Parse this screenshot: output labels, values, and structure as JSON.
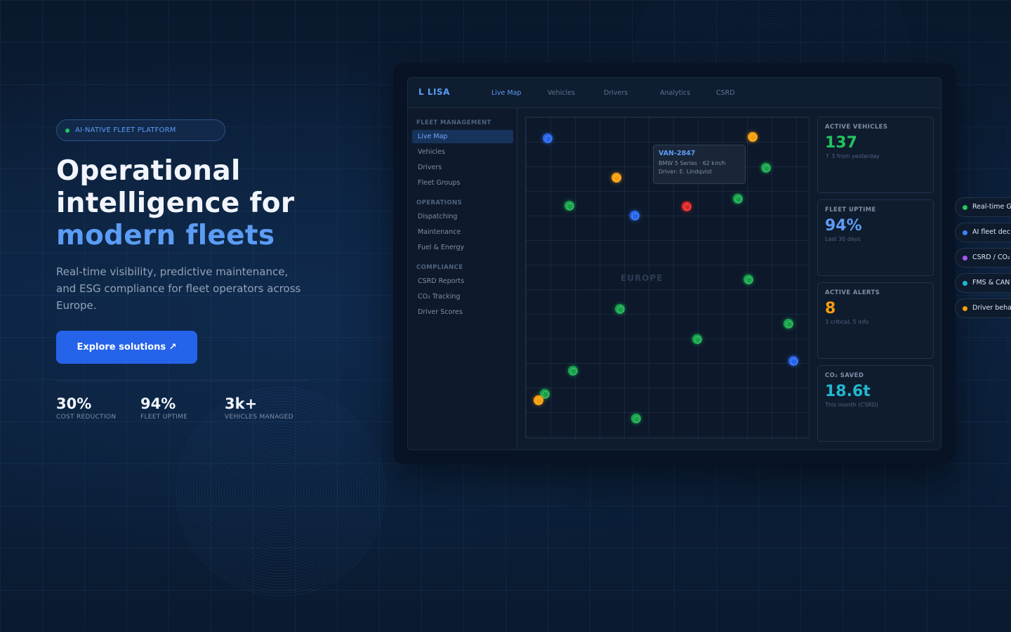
{
  "hero": {
    "badge": "AI-NATIVE FLEET PLATFORM",
    "title_line1": "Operational",
    "title_line2": "intelligence for",
    "title_accent": "modern fleets",
    "subtitle": "Real-time visibility, predictive maintenance, and ESG compliance for fleet operators across Europe.",
    "cta_label": "Explore solutions ↗",
    "stats": [
      {
        "value": "30%",
        "label": "COST REDUCTION"
      },
      {
        "value": "94%",
        "label": "FLEET UPTIME"
      },
      {
        "value": "3k+",
        "label": "VEHICLES MANAGED"
      }
    ]
  },
  "app": {
    "logo": "L LISA",
    "tabs": [
      "Live Map",
      "Vehicles",
      "Drivers",
      "Analytics",
      "CSRD"
    ],
    "sidebar": {
      "sections": [
        {
          "title": "FLEET MANAGEMENT",
          "items": [
            "Live Map",
            "Vehicles",
            "Drivers",
            "Fleet Groups"
          ]
        },
        {
          "title": "OPERATIONS",
          "items": [
            "Dispatching",
            "Maintenance",
            "Fuel & Energy"
          ]
        },
        {
          "title": "COMPLIANCE",
          "items": [
            "CSRD Reports",
            "CO₂ Tracking",
            "Driver Scores"
          ]
        }
      ]
    },
    "map": {
      "region_label": "EUROPE",
      "tooltip": {
        "id": "VAN-2847",
        "line2": "BMW 5 Series · 62 km/h",
        "line3": "Driver: E. Lindqvist"
      },
      "vehicle_status_colors": {
        "active": "#16a34a",
        "selected": "#2563eb",
        "warning": "#f59e0b",
        "critical": "#dc2626"
      }
    },
    "kpis": [
      {
        "label": "ACTIVE VEHICLES",
        "value": "137",
        "sub": "↑ 3 from yesterday",
        "color": "#22c55e"
      },
      {
        "label": "FLEET UPTIME",
        "value": "94%",
        "sub": "Last 30 days",
        "color": "#5b9cf4"
      },
      {
        "label": "ACTIVE ALERTS",
        "value": "8",
        "sub": "3 critical, 5 info",
        "color": "#f59e0b"
      },
      {
        "label": "CO₂ SAVED",
        "value": "18.6t",
        "sub": "This month (CSRD)",
        "color": "#22b8cf"
      }
    ]
  },
  "feature_pills": [
    {
      "label": "Real-time G",
      "color": "#22c55e"
    },
    {
      "label": "AI fleet dec",
      "color": "#3b82f6"
    },
    {
      "label": "CSRD / CO₂",
      "color": "#a855f7"
    },
    {
      "label": "FMS & CAN",
      "color": "#22b8cf"
    },
    {
      "label": "Driver beha",
      "color": "#f59e0b"
    }
  ]
}
